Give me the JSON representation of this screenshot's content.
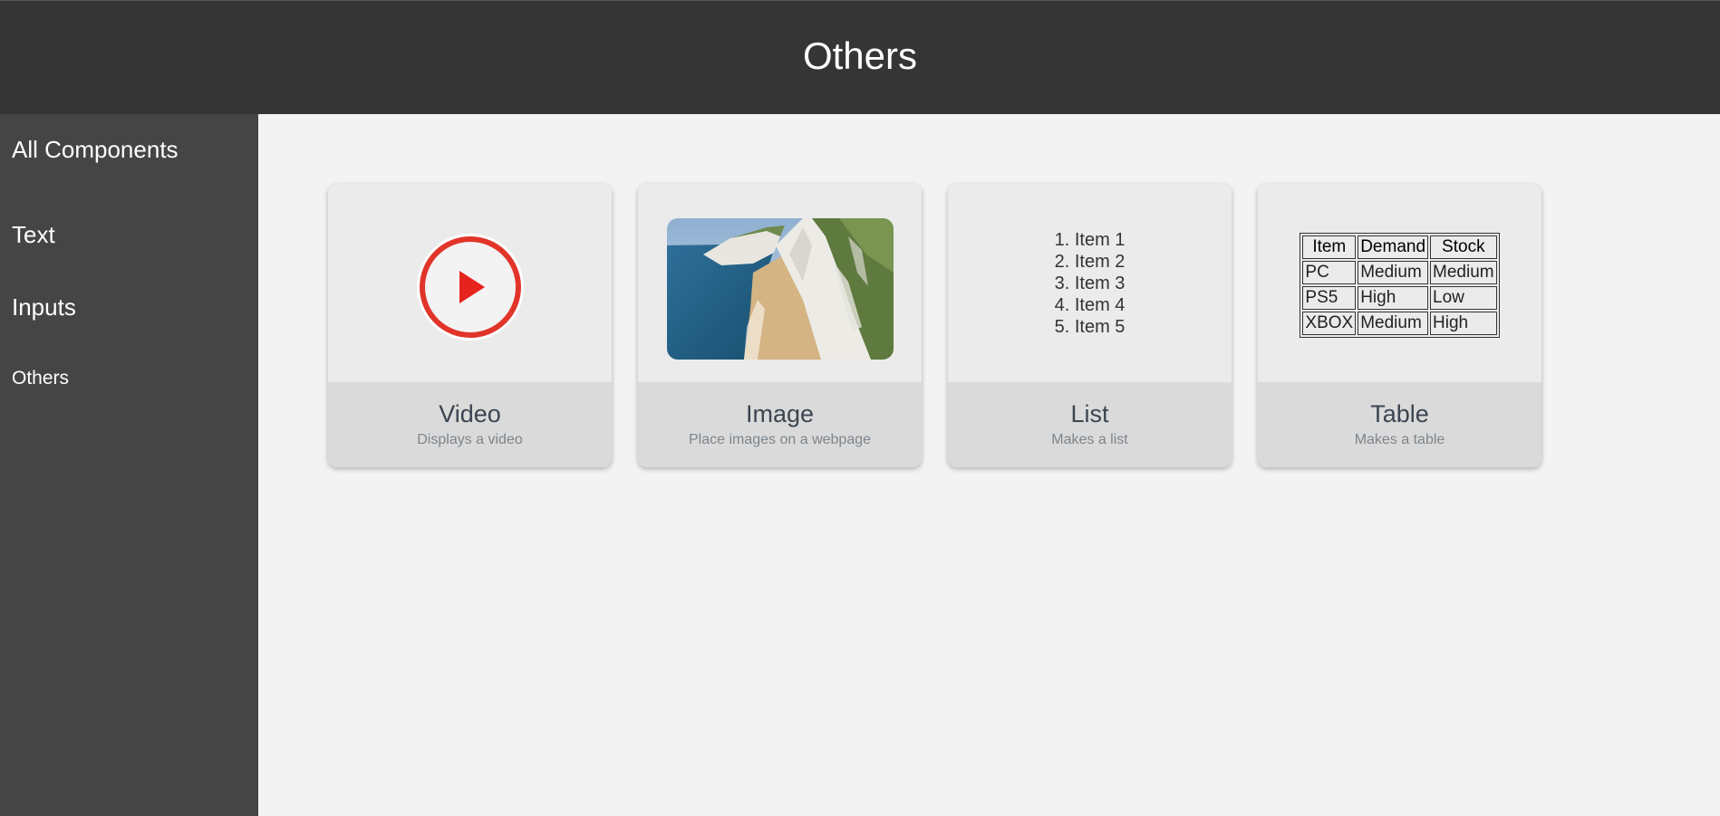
{
  "header": {
    "title": "Others"
  },
  "sidebar": {
    "heading": "All Components",
    "items": [
      {
        "label": "Text"
      },
      {
        "label": "Inputs"
      },
      {
        "label": "Others"
      }
    ]
  },
  "cards": [
    {
      "title": "Video",
      "description": "Displays a video",
      "icon": "play-icon"
    },
    {
      "title": "Image",
      "description": "Place images on a webpage",
      "icon": "coastline-image"
    },
    {
      "title": "List",
      "description": "Makes a list",
      "list_items": [
        "1. Item 1",
        "2. Item 2",
        "3. Item 3",
        "4. Item 4",
        "5. Item 5"
      ]
    },
    {
      "title": "Table",
      "description": "Makes a table",
      "table": {
        "headers": [
          "Item",
          "Demand",
          "Stock"
        ],
        "rows": [
          [
            "PC",
            "Medium",
            "Medium"
          ],
          [
            "PS5",
            "High",
            "Low"
          ],
          [
            "XBOX",
            "Medium",
            "High"
          ]
        ]
      }
    }
  ],
  "colors": {
    "header_bg": "#353535",
    "sidebar_bg": "#454545",
    "content_bg": "#f3f3f3",
    "card_preview_bg": "#ebebeb",
    "card_footer_bg": "#dadada",
    "play_red": "#e1352a"
  }
}
